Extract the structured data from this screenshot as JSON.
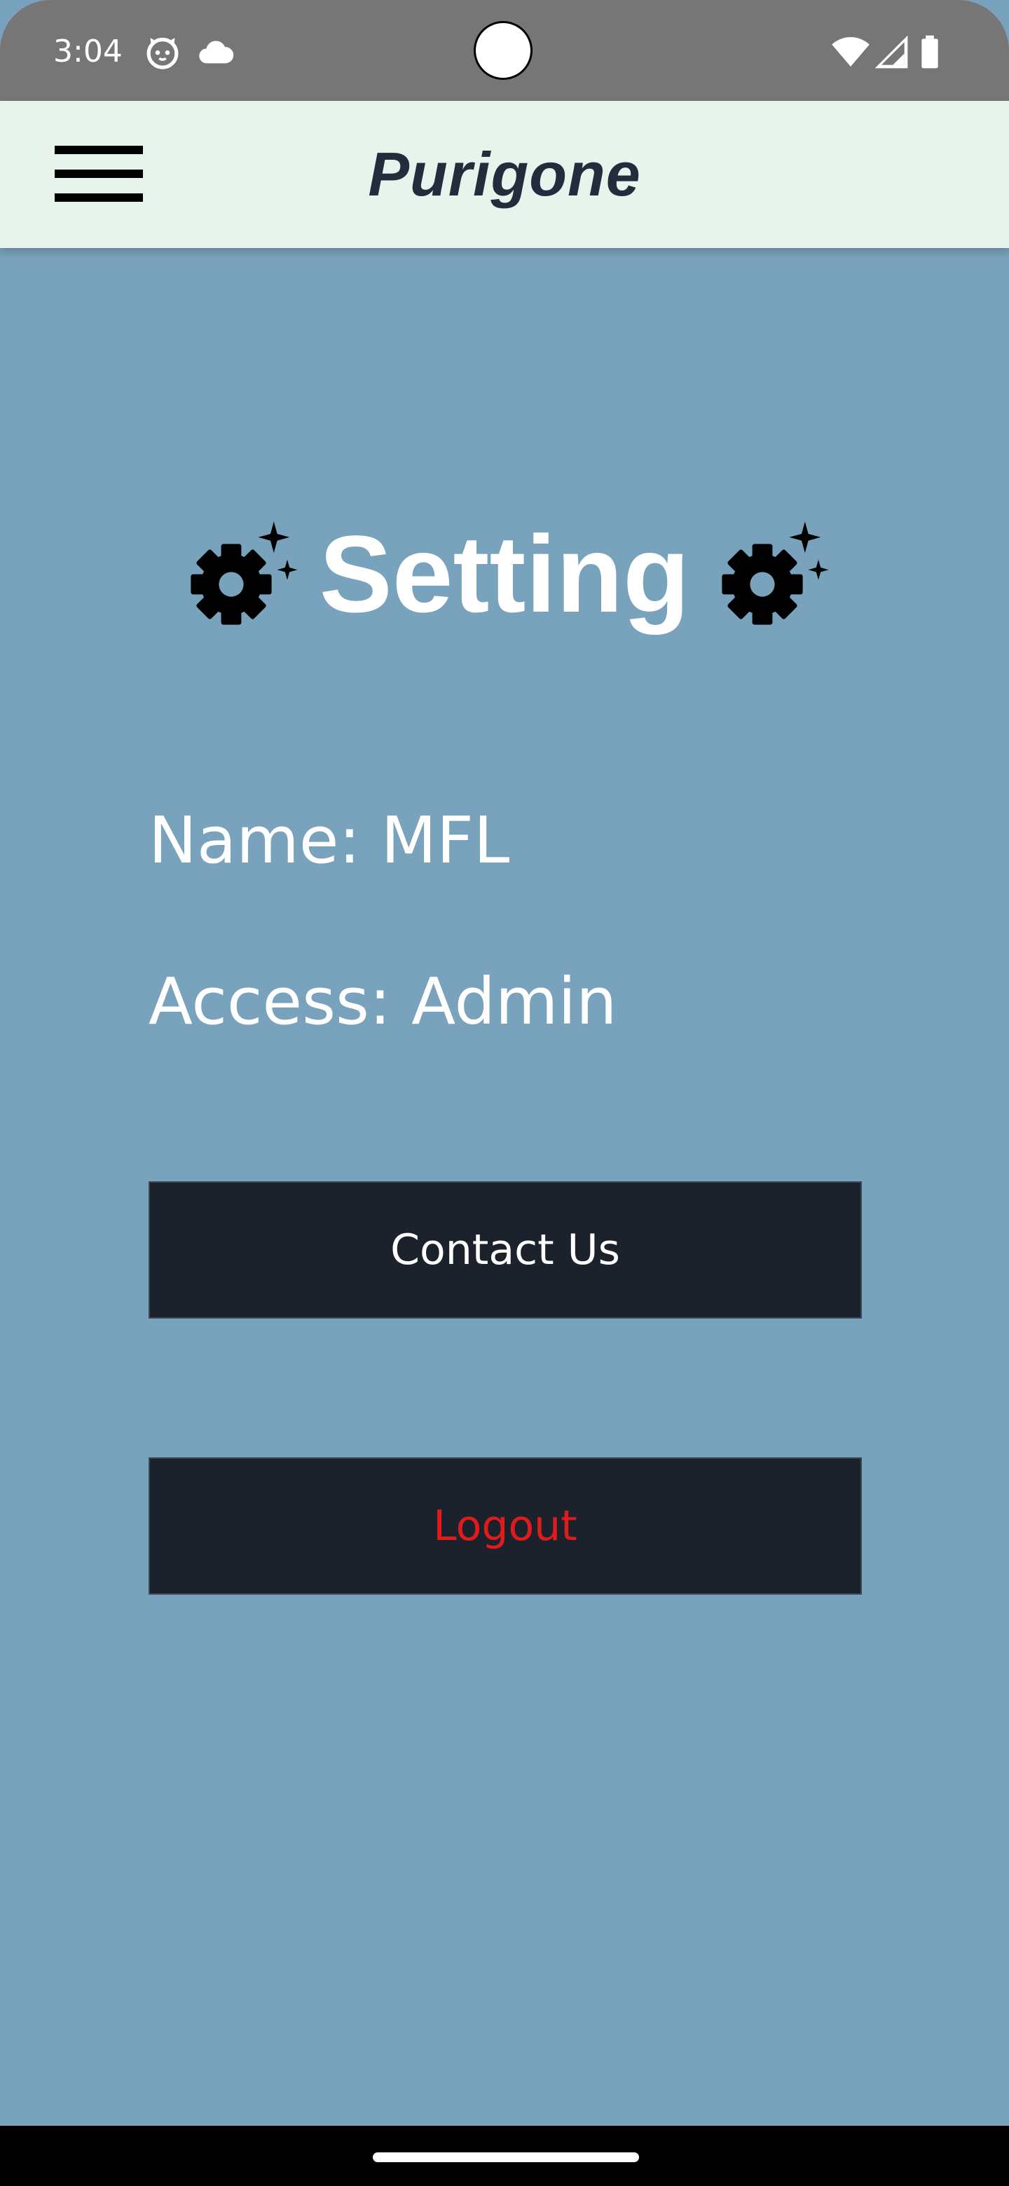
{
  "status_bar": {
    "time": "3:04",
    "left_icons": [
      "cat-face-icon",
      "cloud-icon"
    ],
    "right_icons": [
      "wifi-icon",
      "cell-signal-icon",
      "battery-icon"
    ]
  },
  "app_bar": {
    "title": "Purigone",
    "menu_icon": "hamburger-menu-icon"
  },
  "page": {
    "title": "Setting",
    "title_icons": [
      "settings-sparkle-icon",
      "settings-sparkle-icon"
    ],
    "name_line": "Name: MFL",
    "access_line": "Access: Admin"
  },
  "buttons": {
    "contact_label": "Contact Us",
    "logout_label": "Logout"
  },
  "colors": {
    "background": "#79a2bc",
    "status_bar": "#767676",
    "app_bar": "#e8f3ec",
    "app_title": "#242b3d",
    "button_bg": "#1b222b",
    "contact_text": "#ffffff",
    "logout_text": "#e01b1b"
  }
}
